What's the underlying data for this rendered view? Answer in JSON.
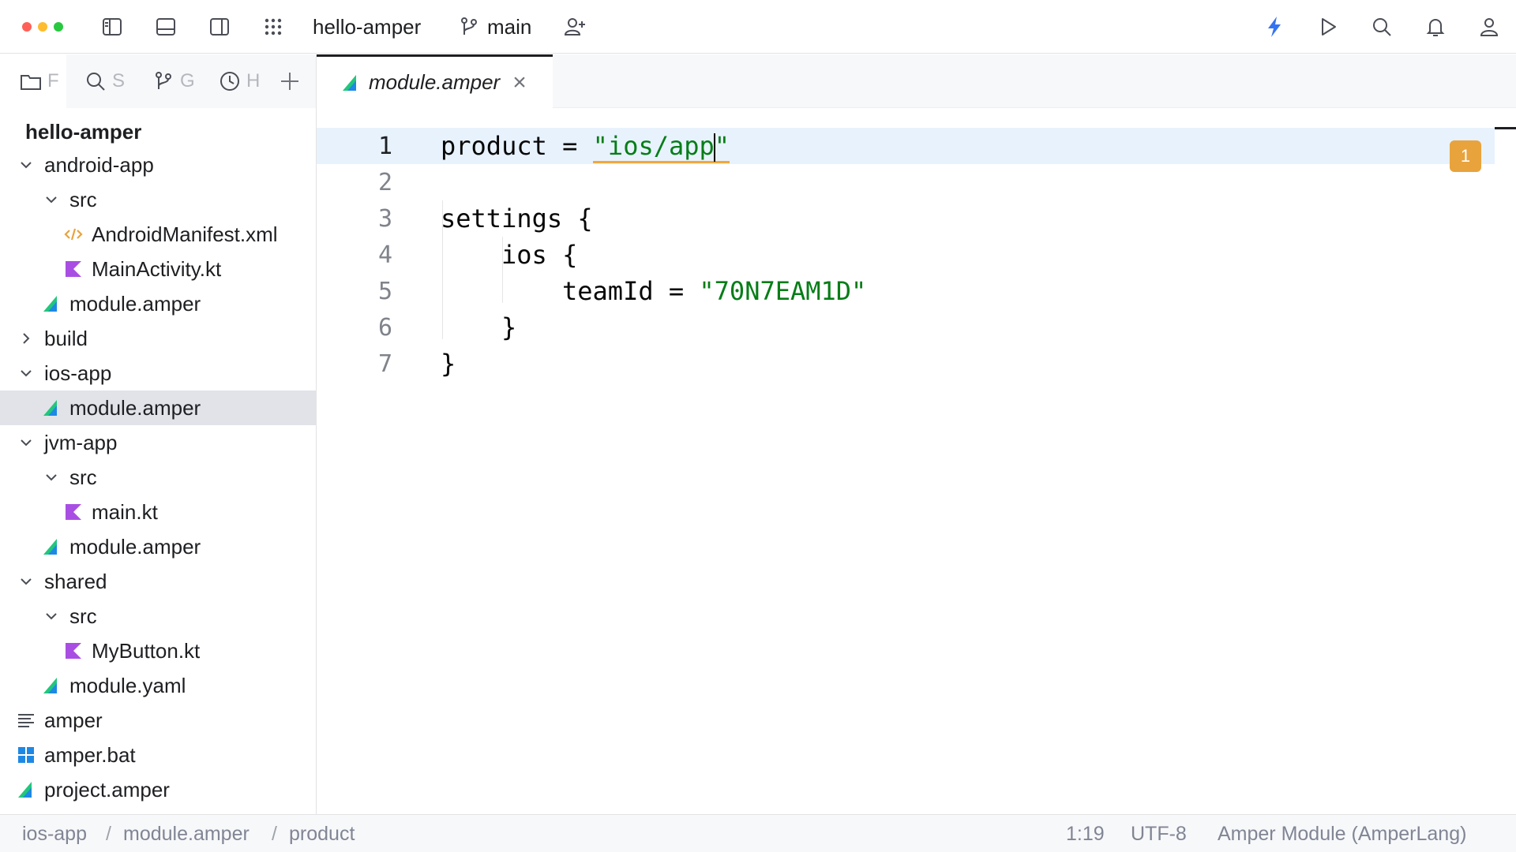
{
  "titlebar": {
    "project_name": "hello-amper",
    "branch": "main",
    "window_controls": {
      "close": "#ff5f57",
      "minimize": "#febc2e",
      "zoom": "#28c840"
    },
    "accent_color": "#3574f0"
  },
  "sidebar": {
    "tabs": [
      {
        "icon": "folder-icon",
        "label": "F"
      },
      {
        "icon": "search-icon",
        "label": "S"
      },
      {
        "icon": "git-icon",
        "label": "G"
      },
      {
        "icon": "clock-icon",
        "label": "H"
      }
    ],
    "root_label": "hello-amper",
    "items": [
      {
        "label": "android-app",
        "icon": "chevron-down-icon"
      },
      {
        "label": "src",
        "icon": "chevron-down-icon"
      },
      {
        "label": "AndroidManifest.xml",
        "icon": "xml-icon"
      },
      {
        "label": "MainActivity.kt",
        "icon": "kotlin-icon"
      },
      {
        "label": "module.amper",
        "icon": "amper-icon"
      },
      {
        "label": "build",
        "icon": "chevron-right-icon"
      },
      {
        "label": "ios-app",
        "icon": "chevron-down-icon"
      },
      {
        "label": "module.amper",
        "icon": "amper-icon",
        "selected": true
      },
      {
        "label": "jvm-app",
        "icon": "chevron-down-icon"
      },
      {
        "label": "src",
        "icon": "chevron-down-icon"
      },
      {
        "label": "main.kt",
        "icon": "kotlin-icon"
      },
      {
        "label": "module.amper",
        "icon": "amper-icon"
      },
      {
        "label": "shared",
        "icon": "chevron-down-icon"
      },
      {
        "label": "src",
        "icon": "chevron-down-icon"
      },
      {
        "label": "MyButton.kt",
        "icon": "kotlin-icon"
      },
      {
        "label": "module.yaml",
        "icon": "amper-icon"
      },
      {
        "label": "amper",
        "icon": "text-file-icon"
      },
      {
        "label": "amper.bat",
        "icon": "windows-icon"
      },
      {
        "label": "project.amper",
        "icon": "amper-icon"
      }
    ]
  },
  "editor": {
    "tab_label": "module.amper",
    "close_symbol": "×",
    "line_numbers": [
      "1",
      "2",
      "3",
      "4",
      "5",
      "6",
      "7"
    ],
    "lines": {
      "l1_key": "product = ",
      "l1_str_a": "\"ios/app",
      "l1_str_b": "\"",
      "l3": "settings {",
      "l4": "ios {",
      "l5_key": "teamId = ",
      "l5_str": "\"70N7EAM1D\"",
      "l6": "}",
      "l7": "}"
    },
    "problems_count": "1",
    "string_color": "#067d17",
    "warning_color": "#e8a33d"
  },
  "statusbar": {
    "breadcrumbs": [
      "ios-app",
      "module.amper",
      "product"
    ],
    "separator": "/",
    "position": "1:19",
    "encoding": "UTF-8",
    "file_type": "Amper Module (AmperLang)"
  }
}
